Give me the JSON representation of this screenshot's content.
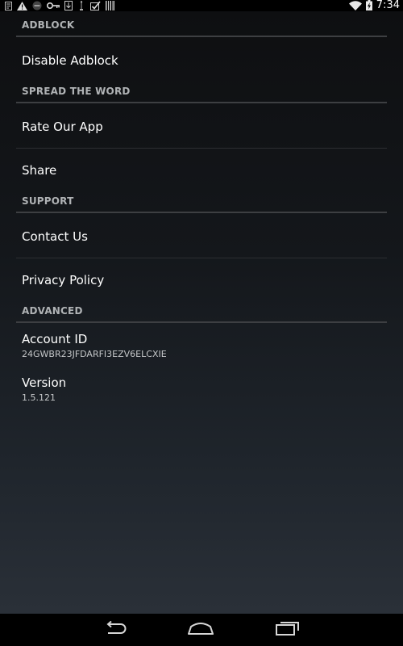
{
  "status_bar": {
    "time": "7:34",
    "icons": [
      "notification-icon",
      "warning-icon",
      "no-entry-icon",
      "key-icon",
      "download-icon",
      "usb-icon",
      "checklist-icon",
      "barcode-icon",
      "wifi-icon",
      "battery-charging-icon"
    ]
  },
  "categories": {
    "adblock": "ADBLOCK",
    "spread": "SPREAD THE WORD",
    "support": "SUPPORT",
    "advanced": "ADVANCED"
  },
  "prefs": {
    "disable_adblock": {
      "title": "Disable Adblock"
    },
    "rate_app": {
      "title": "Rate Our App"
    },
    "share": {
      "title": "Share"
    },
    "contact_us": {
      "title": "Contact Us"
    },
    "privacy_policy": {
      "title": "Privacy Policy"
    },
    "account_id": {
      "title": "Account ID",
      "summary": "24GWBR23JFDARFI3EZV6ELCXIE"
    },
    "version": {
      "title": "Version",
      "summary": "1.5.121"
    }
  },
  "nav_bar": {
    "buttons": [
      "back-icon",
      "home-icon",
      "recents-icon"
    ]
  },
  "colors": {
    "category_text": "#b0b3b5",
    "category_line": "#3d3f42",
    "title_text": "#ffffff",
    "summary_text": "#c4c6c8"
  }
}
